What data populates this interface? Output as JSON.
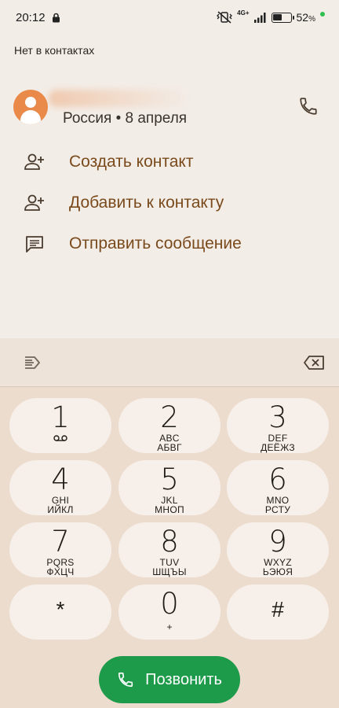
{
  "status_bar": {
    "time": "20:12",
    "network": "4G+",
    "battery": "52",
    "battery_unit": "%",
    "battery_level": 0.52
  },
  "contact": {
    "header": "Нет в контактах",
    "meta": "Россия • 8 апреля"
  },
  "actions": [
    {
      "label": "Создать контакт",
      "icon": "add-person-icon"
    },
    {
      "label": "Добавить к контакту",
      "icon": "add-person-icon"
    },
    {
      "label": "Отправить сообщение",
      "icon": "message-icon"
    }
  ],
  "keypad": [
    {
      "digit": "1",
      "letters": "",
      "letters2": ""
    },
    {
      "digit": "2",
      "letters": "ABC",
      "letters2": "АБВГ"
    },
    {
      "digit": "3",
      "letters": "DEF",
      "letters2": "ДЕЁЖЗ"
    },
    {
      "digit": "4",
      "letters": "GHI",
      "letters2": "ИЙКЛ"
    },
    {
      "digit": "5",
      "letters": "JKL",
      "letters2": "МНОП"
    },
    {
      "digit": "6",
      "letters": "MNO",
      "letters2": "РСТУ"
    },
    {
      "digit": "7",
      "letters": "PQRS",
      "letters2": "ФХЦЧ"
    },
    {
      "digit": "8",
      "letters": "TUV",
      "letters2": "ШЩЪЫ"
    },
    {
      "digit": "9",
      "letters": "WXYZ",
      "letters2": "ЬЭЮЯ"
    },
    {
      "digit": "*",
      "letters": "",
      "letters2": ""
    },
    {
      "digit": "0",
      "letters": "+",
      "letters2": ""
    },
    {
      "digit": "#",
      "letters": "",
      "letters2": ""
    }
  ],
  "call_button": {
    "label": "Позвонить"
  },
  "colors": {
    "accent_text": "#7a4a1c",
    "avatar": "#e98a4a",
    "call_green": "#1d9a4a",
    "key_bg": "#f7f0ea",
    "panel_bg": "#ecdccd"
  }
}
